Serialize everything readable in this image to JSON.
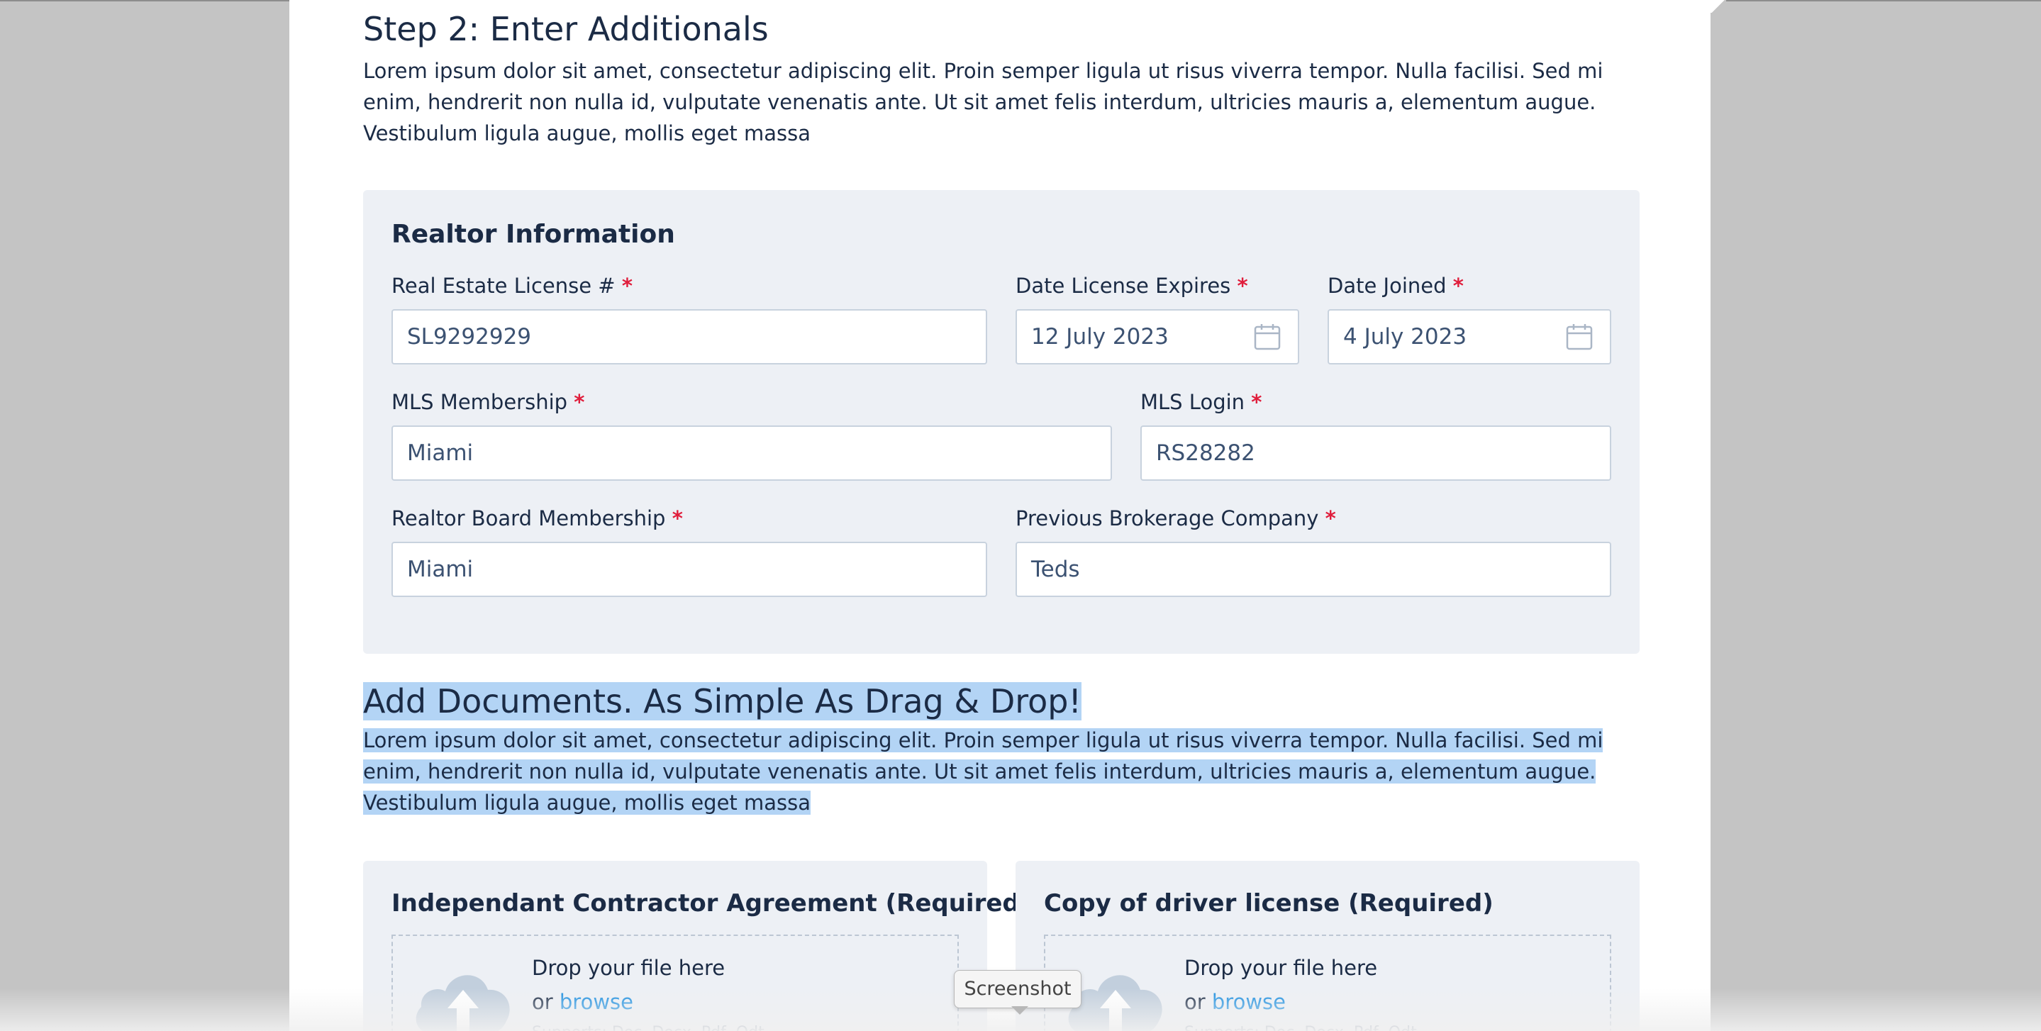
{
  "step": {
    "title": "Step 2: Enter Additionals",
    "description": "Lorem ipsum dolor sit amet, consectetur adipiscing elit. Proin semper ligula ut risus viverra tempor. Nulla facilisi. Sed mi enim, hendrerit non nulla id, vulputate venenatis ante. Ut sit amet felis interdum, ultricies mauris a, elementum augue. Vestibulum ligula augue, mollis eget massa"
  },
  "realtor": {
    "title": "Realtor Information",
    "required_mark": "*",
    "license": {
      "label": "Real Estate License #",
      "value": "SL9292929"
    },
    "license_expires": {
      "label": "Date License Expires",
      "value": "12 July 2023",
      "icon": "calendar-icon"
    },
    "date_joined": {
      "label": "Date Joined",
      "value": "4 July 2023",
      "icon": "calendar-icon"
    },
    "mls_membership": {
      "label": "MLS Membership",
      "value": "Miami"
    },
    "mls_login": {
      "label": "MLS Login",
      "value": "RS28282"
    },
    "board_membership": {
      "label": "Realtor Board Membership",
      "value": "Miami"
    },
    "previous_brokerage": {
      "label": "Previous Brokerage Company",
      "value": "Teds"
    }
  },
  "documents": {
    "title": "Add Documents. As Simple As Drag & Drop!",
    "description": "Lorem ipsum dolor sit amet, consectetur adipiscing elit. Proin semper ligula ut risus viverra tempor. Nulla facilisi. Sed mi enim, hendrerit non nulla id, vulputate venenatis ante. Ut sit amet felis interdum, ultricies mauris a, elementum augue. Vestibulum ligula augue, mollis eget massa",
    "selection_color": "#b3d4f5",
    "uploads": [
      {
        "title": "Independant Contractor Agreement (Required)",
        "drop_text": "Drop your file here",
        "or_text": "or",
        "browse_text": "browse",
        "supports_text": "Supports: Doc, Docx, Pdf, Odt"
      },
      {
        "title": "Copy of driver license (Required)",
        "drop_text": "Drop your file here",
        "or_text": "or",
        "browse_text": "browse",
        "supports_text": "Supports: Doc, Docx, Pdf, Odt"
      }
    ]
  },
  "tooltip": {
    "label": "Screenshot"
  },
  "colors": {
    "required": "#e01e3c",
    "link": "#1d8fe0",
    "card_bg": "#edf0f5",
    "heading": "#1b2b45"
  }
}
